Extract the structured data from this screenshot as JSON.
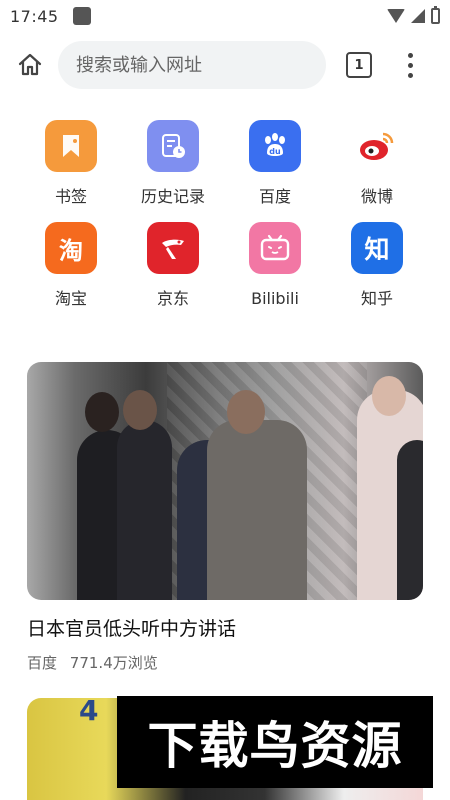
{
  "status_bar": {
    "time": "17:45"
  },
  "toolbar": {
    "search_placeholder": "搜索或输入网址",
    "tab_count": "1"
  },
  "shortcuts": [
    {
      "label": "书签",
      "icon": "bookmark-icon",
      "color": "#f59a3c"
    },
    {
      "label": "历史记录",
      "icon": "history-icon",
      "color": "#7f8ff0"
    },
    {
      "label": "百度",
      "icon": "baidu-paw-icon",
      "color": "#3a6ff0"
    },
    {
      "label": "微博",
      "icon": "weibo-icon",
      "color": "#e0242b"
    },
    {
      "label": "淘宝",
      "icon": "taobao-icon",
      "glyph": "淘",
      "color": "#f56a1e"
    },
    {
      "label": "京东",
      "icon": "jd-dog-icon",
      "color": "#e0242b"
    },
    {
      "label": "Bilibili",
      "icon": "bilibili-tv-icon",
      "color": "#f277a4"
    },
    {
      "label": "知乎",
      "icon": "zhihu-icon",
      "glyph": "知",
      "color": "#1f6fe6"
    }
  ],
  "feed": [
    {
      "title": "日本官员低头听中方讲话",
      "source": "百度",
      "views": "771.4万浏览"
    }
  ],
  "card2": {
    "number": "4"
  },
  "watermark": {
    "text": "下载鸟资源"
  }
}
